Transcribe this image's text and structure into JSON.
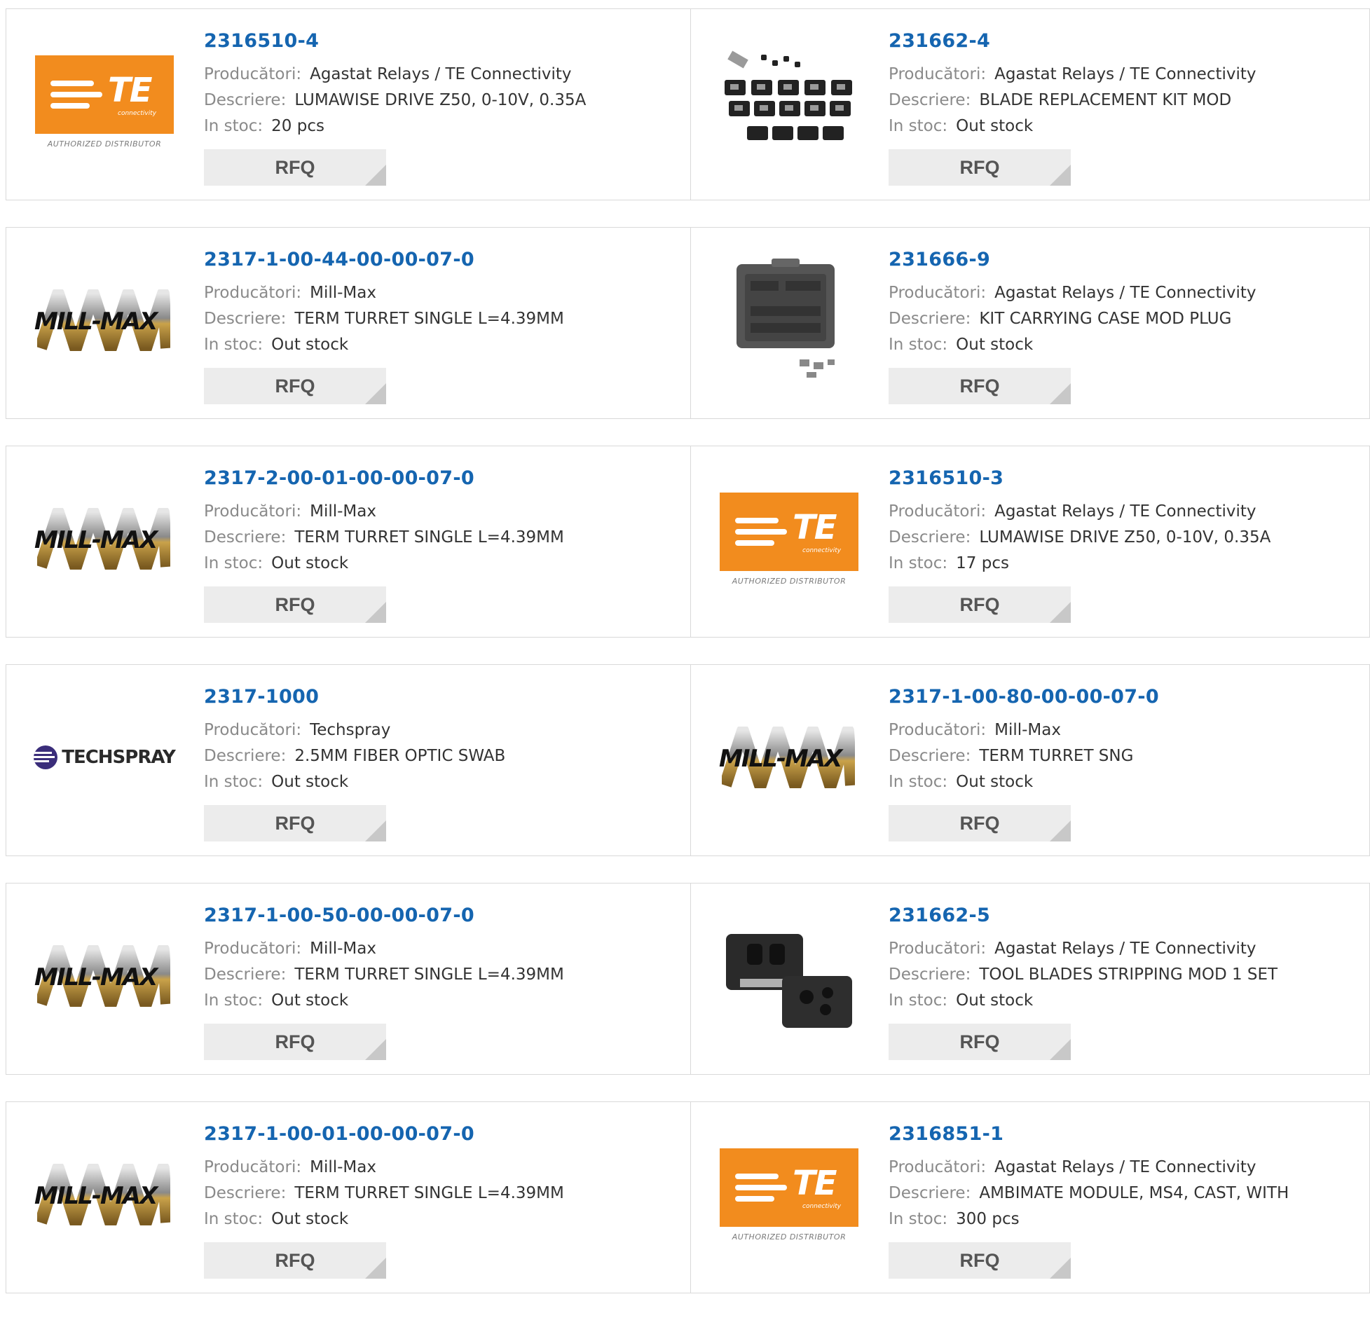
{
  "labels": {
    "manufacturer": "Producători:",
    "description": "Descriere:",
    "stock": "In stoc:",
    "rfq": "RFQ"
  },
  "logos": {
    "te_text": "TE",
    "te_sub": "connectivity",
    "te_dist": "AUTHORIZED DISTRIBUTOR",
    "millmax_text": "MILL-MAX",
    "techspray_text": "TECHSPRAY"
  },
  "colors": {
    "link": "#1565b0",
    "te_orange": "#f28c1e",
    "button_bg": "#ececec"
  },
  "products": [
    {
      "pn": "2316510-4",
      "manufacturer": "Agastat Relays / TE Connectivity",
      "description": "LUMAWISE DRIVE Z50, 0-10V, 0.35A",
      "stock": "20 pcs",
      "image": "te-logo"
    },
    {
      "pn": "231662-4",
      "manufacturer": "Agastat Relays / TE Connectivity",
      "description": "BLADE REPLACEMENT KIT MOD",
      "stock": "Out stock",
      "image": "blade-kit-photo"
    },
    {
      "pn": "2317-1-00-44-00-00-07-0",
      "manufacturer": "Mill-Max",
      "description": "TERM TURRET SINGLE L=4.39MM",
      "stock": "Out stock",
      "image": "millmax-logo"
    },
    {
      "pn": "231666-9",
      "manufacturer": "Agastat Relays / TE Connectivity",
      "description": "KIT CARRYING CASE MOD PLUG",
      "stock": "Out stock",
      "image": "carrying-case-photo"
    },
    {
      "pn": "2317-2-00-01-00-00-07-0",
      "manufacturer": "Mill-Max",
      "description": "TERM TURRET SINGLE L=4.39MM",
      "stock": "Out stock",
      "image": "millmax-logo"
    },
    {
      "pn": "2316510-3",
      "manufacturer": "Agastat Relays / TE Connectivity",
      "description": "LUMAWISE DRIVE Z50, 0-10V, 0.35A",
      "stock": "17 pcs",
      "image": "te-logo"
    },
    {
      "pn": "2317-1000",
      "manufacturer": "Techspray",
      "description": "2.5MM FIBER OPTIC SWAB",
      "stock": "Out stock",
      "image": "techspray-logo"
    },
    {
      "pn": "2317-1-00-80-00-00-07-0",
      "manufacturer": "Mill-Max",
      "description": "TERM TURRET SNG",
      "stock": "Out stock",
      "image": "millmax-logo"
    },
    {
      "pn": "2317-1-00-50-00-00-07-0",
      "manufacturer": "Mill-Max",
      "description": "TERM TURRET SINGLE L=4.39MM",
      "stock": "Out stock",
      "image": "millmax-logo"
    },
    {
      "pn": "231662-5",
      "manufacturer": "Agastat Relays / TE Connectivity",
      "description": "TOOL BLADES STRIPPING MOD 1 SET",
      "stock": "Out stock",
      "image": "blades-photo"
    },
    {
      "pn": "2317-1-00-01-00-00-07-0",
      "manufacturer": "Mill-Max",
      "description": "TERM TURRET SINGLE L=4.39MM",
      "stock": "Out stock",
      "image": "millmax-logo"
    },
    {
      "pn": "2316851-1",
      "manufacturer": "Agastat Relays / TE Connectivity",
      "description": "AMBIMATE MODULE, MS4, CAST, WITH",
      "stock": "300 pcs",
      "image": "te-logo"
    }
  ]
}
